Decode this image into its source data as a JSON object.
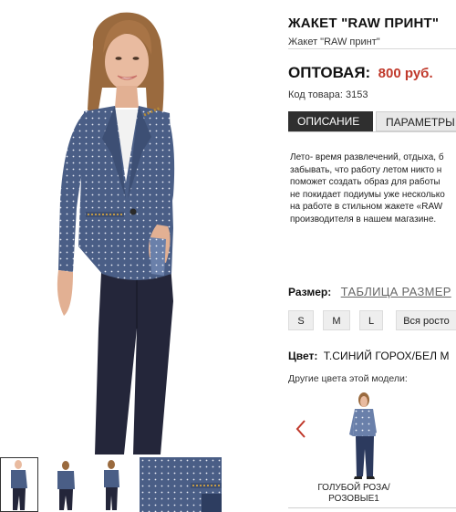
{
  "product": {
    "title": "ЖАКЕТ \"RAW ПРИНТ\"",
    "subtitle": "Жакет \"RAW принт\"",
    "price_label": "ОПТОВАЯ:",
    "price_value": "800 руб.",
    "sku": "Код товара: 3153"
  },
  "tabs": [
    {
      "label": "ОПИСАНИЕ",
      "active": true
    },
    {
      "label": "ПАРАМЕТРЫ",
      "active": false
    }
  ],
  "description": [
    "Лето- время развлечений, отдыха, б",
    "забывать, что работу летом никто н",
    "поможет создать образ для работы",
    "не покидает подиумы уже несколько",
    "на работе в стильном жакете «RAW",
    "производителя в нашем магазине."
  ],
  "size": {
    "label": "Размер:",
    "table_link": "ТАБЛИЦА РАЗМЕР",
    "options": [
      "S",
      "M",
      "L",
      "Вся росто"
    ]
  },
  "color": {
    "label": "Цвет:",
    "value": "Т.СИНИЙ ГОРОХ/БЕЛ М",
    "other_label": "Другие цвета этой модели:",
    "variant_caption_1": "ГОЛУБОЙ РОЗА/",
    "variant_caption_2": "РОЗОВЫЕ1"
  },
  "icons": {
    "prev_arrow": "chevron-left-icon"
  },
  "colors": {
    "price": "#c0392b",
    "active_tab": "#2f2f2f",
    "jacket": "#4a5e86",
    "pants": "#24263a"
  }
}
